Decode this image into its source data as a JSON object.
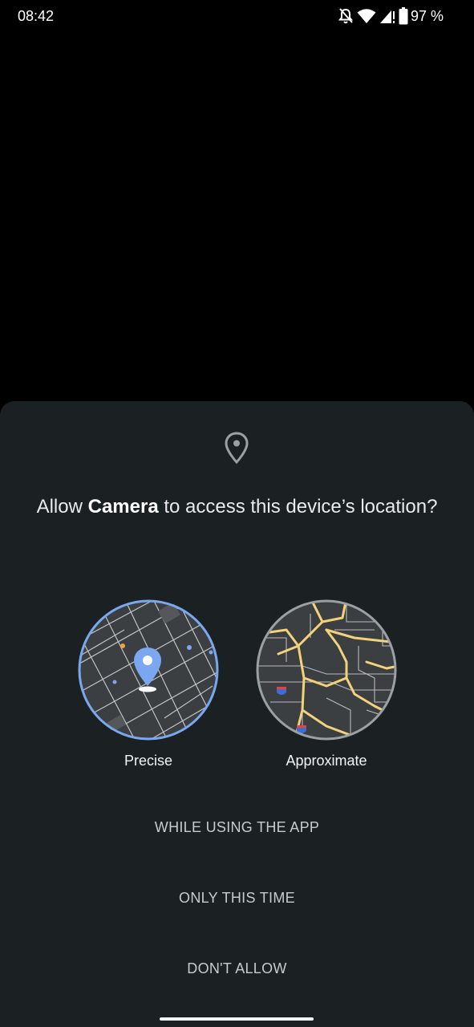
{
  "status_bar": {
    "time": "08:42",
    "battery": "97 %",
    "icons": [
      "bell-off-icon",
      "wifi-icon",
      "signal-icon",
      "battery-icon"
    ]
  },
  "dialog": {
    "icon": "location-pin-icon",
    "title_prefix": "Allow ",
    "app_name": "Camera",
    "title_suffix": " to access this device’s location?",
    "options": [
      {
        "label": "Precise",
        "selected": true
      },
      {
        "label": "Approximate",
        "selected": false
      }
    ],
    "actions": {
      "while_using": "WHILE USING THE APP",
      "only_this_time": "ONLY THIS TIME",
      "dont_allow": "DON'T ALLOW"
    }
  },
  "colors": {
    "sheet_bg": "#1b2122",
    "accent": "#7ba7f0",
    "road": "#f2d27a"
  }
}
